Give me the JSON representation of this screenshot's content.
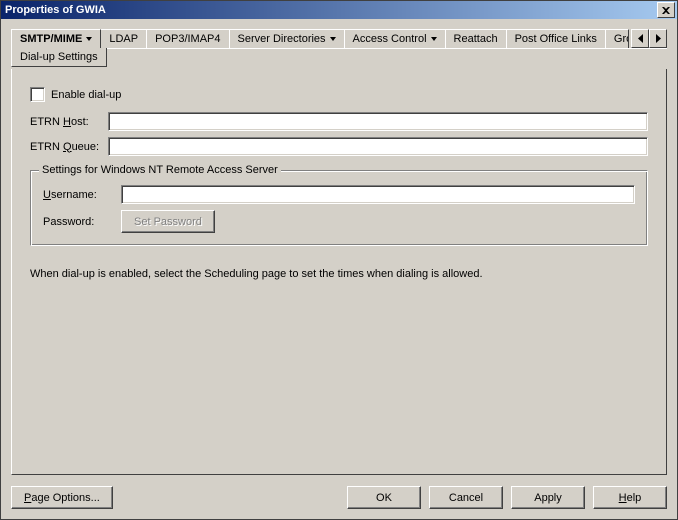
{
  "window": {
    "title": "Properties of GWIA"
  },
  "tabs": {
    "items": [
      {
        "label": "SMTP/MIME",
        "dropdown": true,
        "active": true
      },
      {
        "label": "LDAP",
        "dropdown": false
      },
      {
        "label": "POP3/IMAP4",
        "dropdown": false
      },
      {
        "label": "Server Directories",
        "dropdown": true
      },
      {
        "label": "Access Control",
        "dropdown": true
      },
      {
        "label": "Reattach",
        "dropdown": false
      },
      {
        "label": "Post Office Links",
        "dropdown": false
      },
      {
        "label": "GroupW",
        "dropdown": false,
        "cut": true
      }
    ],
    "subtab": "Dial-up Settings"
  },
  "form": {
    "enable_label_pre": "E",
    "enable_label_mid": "n",
    "enable_label_post": "able dial-up",
    "etrn_host_label": "ETRN Host:",
    "etrn_host_u": "H",
    "etrn_host_value": "",
    "etrn_queue_label": "ETRN Queue:",
    "etrn_queue_u": "Q",
    "etrn_queue_value": "",
    "ras_legend": "Settings for Windows NT Remote Access Server",
    "username_label": "Username:",
    "username_u": "U",
    "username_value": "",
    "password_label": "Password:",
    "set_password_u": "S",
    "set_password_rest": "et Password",
    "info_text": "When dial-up is enabled, select the Scheduling page to set the times when dialing is allowed."
  },
  "footer": {
    "page_options_u": "P",
    "page_options_rest": "age Options...",
    "ok": "OK",
    "cancel": "Cancel",
    "apply": "Apply",
    "help_u": "H",
    "help_rest": "elp"
  }
}
